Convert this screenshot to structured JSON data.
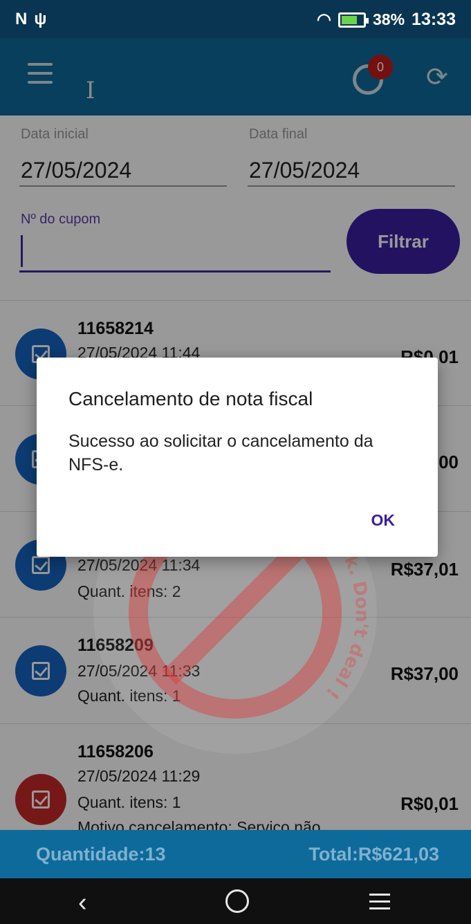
{
  "status_bar": {
    "left_icons": [
      "n-icon",
      "usb-icon"
    ],
    "battery_pct": "38%",
    "time": "13:33"
  },
  "app_bar": {
    "badge_count": "0"
  },
  "filters": {
    "start_label": "Data inicial",
    "start_value": "27/05/2024",
    "end_label": "Data final",
    "end_value": "27/05/2024",
    "cupom_label": "Nº do cupom",
    "cupom_value": "",
    "filter_button": "Filtrar"
  },
  "list": [
    {
      "number": "11658214",
      "datetime": "27/05/2024 11:44",
      "items": "",
      "value": "R$0,01",
      "status": "ok"
    },
    {
      "number": "",
      "datetime": "",
      "items": "",
      "value": "00",
      "status": "ok"
    },
    {
      "number": "",
      "datetime": "27/05/2024 11:34",
      "items": "Quant. itens: 2",
      "value": "R$37,01",
      "status": "ok"
    },
    {
      "number": "11658209",
      "datetime": "27/05/2024 11:33",
      "items": "Quant. itens: 1",
      "value": "R$37,00",
      "status": "ok"
    },
    {
      "number": "11658206",
      "datetime": "27/05/2024 11:29",
      "items": "Quant. itens: 1",
      "reason": "Motivo cancelamento: Serviço não",
      "value": "R$0,01",
      "status": "cancelled"
    }
  ],
  "dialog": {
    "title": "Cancelamento de nota fiscal",
    "message": "Sucesso ao solicitar o cancelamento da NFS-e.",
    "ok": "OK"
  },
  "watermark": {
    "text": "This device at risk. Don't deal !"
  },
  "summary": {
    "quantity": "Quantidade:13",
    "total": "Total:R$621,03"
  },
  "colors": {
    "app_bar": "#0e6a9a",
    "accent": "#3b1fa0",
    "status_ok": "#1565c0",
    "status_cancelled": "#c62828"
  }
}
